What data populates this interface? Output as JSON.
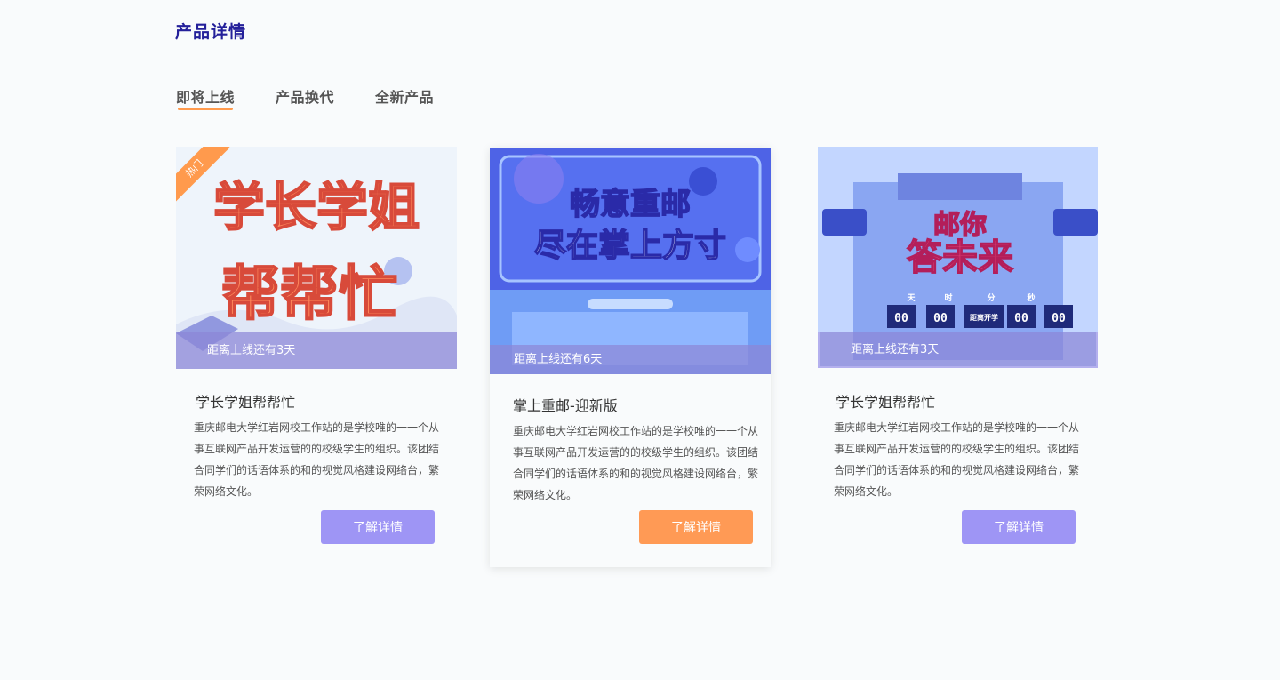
{
  "section": {
    "title": "产品详情"
  },
  "tabs": [
    {
      "label": "即将上线",
      "active": true
    },
    {
      "label": "产品换代",
      "active": false
    },
    {
      "label": "全新产品",
      "active": false
    }
  ],
  "colors": {
    "accent_orange": "#ff9a4d",
    "accent_purple": "#9e95f5",
    "title_blue": "#24209a"
  },
  "cards": [
    {
      "ribbon": "热门",
      "banner_text_line1": "学长学姐",
      "banner_text_line2": "帮帮忙",
      "countdown": "距离上线还有3天",
      "title": "学长学姐帮帮忙",
      "desc": "重庆邮电大学红岩网校工作站的是学校唯的一一个从事互联网产品开发运营的的校级学生的组织。该团结合同学们的话语体系的和的视觉风格建设网络台，繁荣网络文化。",
      "button": "了解详情"
    },
    {
      "banner_text_line1": "畅意重邮",
      "banner_text_line2": "尽在掌上方寸",
      "countdown": "距离上线还有6天",
      "title": "掌上重邮-迎新版",
      "desc": "重庆邮电大学红岩网校工作站的是学校唯的一一个从事互联网产品开发运营的的校级学生的组织。该团结合同学们的话语体系的和的视觉风格建设网络台，繁荣网络文化。",
      "button": "了解详情"
    },
    {
      "banner_text_line1": "邮你",
      "banner_text_line2": "答未来",
      "banner_labels": [
        "天",
        "时",
        "分",
        "秒"
      ],
      "banner_timer": [
        "00",
        "00",
        "距离开学",
        "00",
        "00"
      ],
      "countdown": "距离上线还有3天",
      "title": "学长学姐帮帮忙",
      "desc": "重庆邮电大学红岩网校工作站的是学校唯的一一个从事互联网产品开发运营的的校级学生的组织。该团结合同学们的话语体系的和的视觉风格建设网络台，繁荣网络文化。",
      "button": "了解详情"
    }
  ]
}
